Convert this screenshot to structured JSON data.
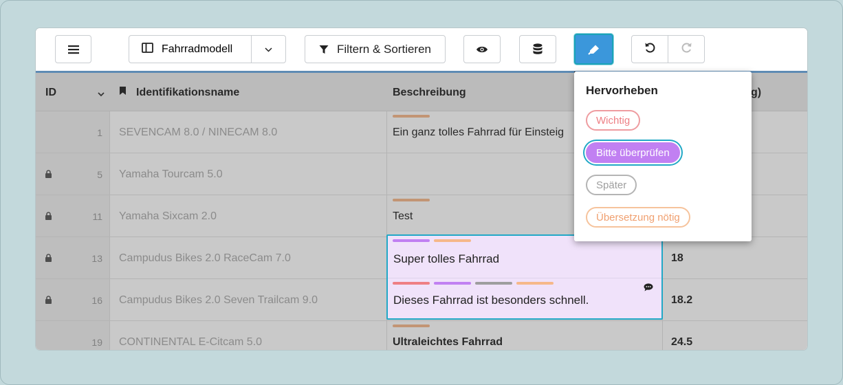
{
  "toolbar": {
    "view_label": "Fahrradmodell",
    "filter_label": "Filtern & Sortieren",
    "icons": {
      "menu": "hamburger-icon",
      "view": "table-columns-icon",
      "dropdown": "chevron-down-icon",
      "filter": "filter-icon",
      "visibility": "eye-icon",
      "database": "database-icon",
      "highlight": "highlighter-icon",
      "undo": "undo-icon",
      "redo": "redo-icon"
    }
  },
  "table": {
    "headers": {
      "id": "ID",
      "name": "Identifikationsname",
      "description": "Beschreibung",
      "weight": "g)"
    },
    "rows": [
      {
        "id": "1",
        "locked": false,
        "name": "SEVENCAM 8.0 / NINECAM 8.0",
        "description": "Ein ganz tolles Fahrrad für Einsteig",
        "weight": ""
      },
      {
        "id": "5",
        "locked": true,
        "name": "Yamaha Tourcam 5.0",
        "description": "",
        "weight": ""
      },
      {
        "id": "11",
        "locked": true,
        "name": "Yamaha Sixcam 2.0",
        "description": "Test",
        "weight": ""
      },
      {
        "id": "13",
        "locked": true,
        "name": "Campudus Bikes 2.0 RaceCam 7.0",
        "description": "",
        "weight": "18"
      },
      {
        "id": "16",
        "locked": true,
        "name": "Campudus Bikes 2.0 Seven Trailcam 9.0",
        "description": "",
        "weight": "18.2"
      },
      {
        "id": "19",
        "locked": false,
        "name": "CONTINENTAL E-Citcam 5.0",
        "description": "Ultraleichtes Fahrrad",
        "weight": "24.5"
      }
    ]
  },
  "edit_cell": {
    "line1": "Super tolles Fahrrad",
    "line2": "Dieses Fahrrad ist besonders schnell."
  },
  "highlight_menu": {
    "title": "Hervorheben",
    "options": [
      {
        "label": "Wichtig",
        "color": "#ee7f84",
        "selected": false
      },
      {
        "label": "Bitte überprüfen",
        "color": "#c180f2",
        "selected": true
      },
      {
        "label": "Später",
        "color": "#a8a8a8",
        "selected": false
      },
      {
        "label": "Übersetzung nötig",
        "color": "#f6b88a",
        "selected": false
      }
    ]
  },
  "colors": {
    "important": "#ee7f84",
    "review": "#c180f2",
    "later": "#9e9e9e",
    "translation": "#f6b88a",
    "accent": "#3b97db"
  }
}
